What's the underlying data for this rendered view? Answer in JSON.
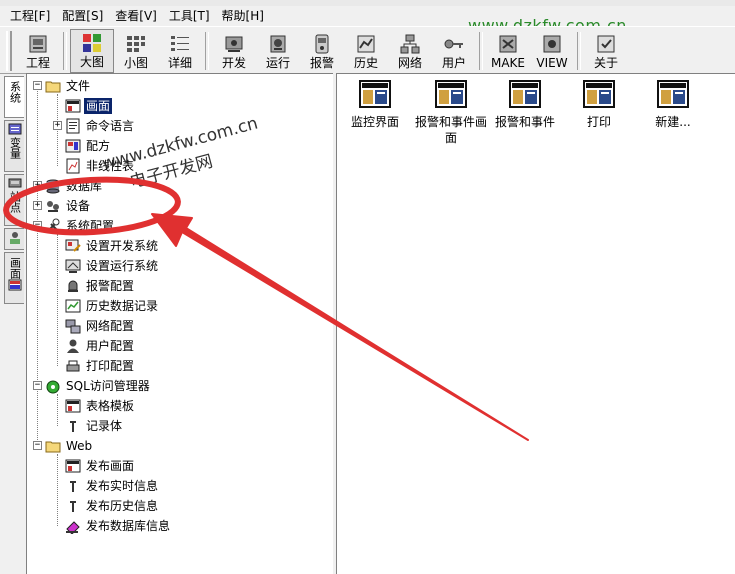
{
  "menubar": {
    "items": [
      "工程[F]",
      "配置[S]",
      "查看[V]",
      "工具[T]",
      "帮助[H]"
    ]
  },
  "toolbar": {
    "buttons": [
      {
        "label": "工程",
        "icon": "project-icon"
      },
      {
        "label": "大图",
        "icon": "large-icons-icon",
        "pressed": true
      },
      {
        "label": "小图",
        "icon": "small-icons-icon"
      },
      {
        "label": "详细",
        "icon": "details-icon"
      },
      {
        "label": "开发",
        "icon": "develop-icon"
      },
      {
        "label": "运行",
        "icon": "run-icon"
      },
      {
        "label": "报警",
        "icon": "alarm-icon"
      },
      {
        "label": "历史",
        "icon": "history-icon"
      },
      {
        "label": "网络",
        "icon": "network-icon"
      },
      {
        "label": "用户",
        "icon": "user-icon"
      },
      {
        "label": "MAKE",
        "icon": "make-icon"
      },
      {
        "label": "VIEW",
        "icon": "view-icon"
      },
      {
        "label": "关于",
        "icon": "about-icon"
      }
    ]
  },
  "side_tabs": [
    "系统",
    "变量",
    "站点",
    "画面"
  ],
  "tree": {
    "root_file": "文件",
    "screens": "画面",
    "command_language": "命令语言",
    "recipe": "配方",
    "nonlinear_table": "非线性表",
    "database": "数据库",
    "device": "设备",
    "system_config": "系统配置",
    "dev_settings": "设置开发系统",
    "run_settings": "设置运行系统",
    "alarm_config": "报警配置",
    "history_record": "历史数据记录",
    "network_config": "网络配置",
    "user_config": "用户配置",
    "print_config": "打印配置",
    "sql_manager": "SQL访问管理器",
    "table_template": "表格模板",
    "record_body": "记录体",
    "web": "Web",
    "publish_screen": "发布画面",
    "publish_realtime": "发布实时信息",
    "publish_history": "发布历史信息",
    "publish_db": "发布数据库信息"
  },
  "content": {
    "items": [
      "监控界面",
      "报警和事件画面",
      "报警和事件",
      "打印",
      "新建..."
    ]
  },
  "watermarks": {
    "top_right": "www.dzkfw.com.cn",
    "diag_line1": "www.dzkfw.com.cn",
    "diag_line2": "电子开发网"
  },
  "colors": {
    "selection": "#0a246a",
    "annotation": "#e03030",
    "watermark": "#2a8a2a"
  }
}
